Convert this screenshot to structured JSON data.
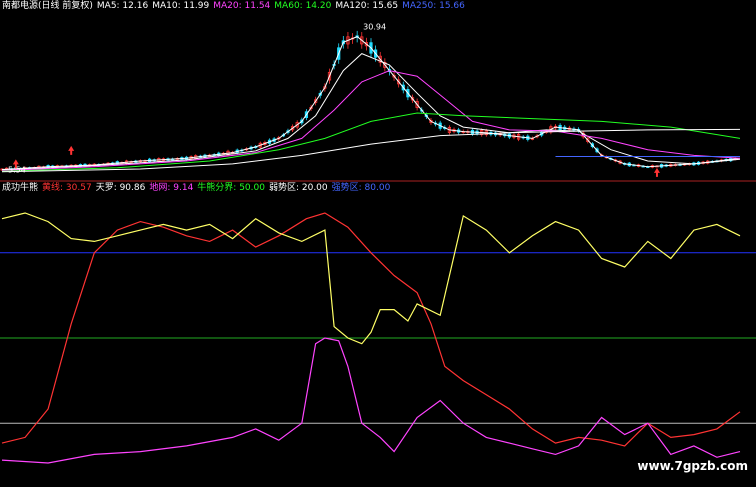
{
  "top_panel": {
    "title": "南都电源(日线 前复权)",
    "items": [
      {
        "label": "MA5: 12.16",
        "color": "#ffffff"
      },
      {
        "label": "MA10: 11.99",
        "color": "#ffffff"
      },
      {
        "label": "MA20: 11.54",
        "color": "#ff44ff"
      },
      {
        "label": "MA60: 14.20",
        "color": "#22ff22"
      },
      {
        "label": "MA120: 15.65",
        "color": "#ffffff"
      },
      {
        "label": "MA250: 15.66",
        "color": "#4466ff"
      }
    ],
    "price_high_label": "30.94",
    "price_low_label": "5.54"
  },
  "bottom_panel": {
    "title": "成功牛熊",
    "items": [
      {
        "label": "黄线: 30.57",
        "color": "#ff3333"
      },
      {
        "label": "天罗: 90.86",
        "color": "#ffffff"
      },
      {
        "label": "地网: 9.14",
        "color": "#ff44ff"
      },
      {
        "label": "牛熊分界: 50.00",
        "color": "#22ff22"
      },
      {
        "label": "弱势区: 20.00",
        "color": "#ffffff"
      },
      {
        "label": "强势区: 80.00",
        "color": "#4466ff"
      }
    ]
  },
  "watermark": "www.7gpzb.com",
  "chart_data": [
    {
      "type": "line",
      "panel": "price",
      "ylim": [
        4,
        33
      ],
      "x_count": 160,
      "series": [
        {
          "name": "MA5",
          "color": "#ffffff",
          "points": [
            [
              0,
              5.5
            ],
            [
              10,
              6
            ],
            [
              20,
              6.3
            ],
            [
              30,
              7
            ],
            [
              40,
              7.5
            ],
            [
              50,
              8.5
            ],
            [
              55,
              9.5
            ],
            [
              60,
              11
            ],
            [
              65,
              14
            ],
            [
              70,
              20
            ],
            [
              74,
              28
            ],
            [
              77,
              29
            ],
            [
              80,
              27
            ],
            [
              85,
              22
            ],
            [
              90,
              17
            ],
            [
              93,
              14
            ],
            [
              97,
              12.5
            ],
            [
              100,
              12.2
            ],
            [
              105,
              12
            ],
            [
              110,
              11.5
            ],
            [
              115,
              11
            ],
            [
              120,
              13
            ],
            [
              125,
              12.5
            ],
            [
              130,
              8
            ],
            [
              135,
              6.5
            ],
            [
              140,
              6
            ],
            [
              150,
              6.5
            ],
            [
              160,
              7.5
            ]
          ]
        },
        {
          "name": "MA10",
          "color": "#ffffff",
          "points": [
            [
              0,
              5.4
            ],
            [
              20,
              6.2
            ],
            [
              40,
              7.2
            ],
            [
              55,
              8.8
            ],
            [
              62,
              11
            ],
            [
              68,
              15
            ],
            [
              74,
              23
            ],
            [
              78,
              26
            ],
            [
              84,
              24
            ],
            [
              90,
              19
            ],
            [
              95,
              15
            ],
            [
              100,
              13
            ],
            [
              110,
              12
            ],
            [
              118,
              12.5
            ],
            [
              125,
              12.3
            ],
            [
              132,
              9
            ],
            [
              140,
              7
            ],
            [
              150,
              6.5
            ],
            [
              160,
              7.3
            ]
          ]
        },
        {
          "name": "MA20",
          "color": "#ff44ff",
          "points": [
            [
              0,
              5.3
            ],
            [
              20,
              6
            ],
            [
              40,
              7
            ],
            [
              55,
              8.5
            ],
            [
              65,
              11
            ],
            [
              72,
              16
            ],
            [
              78,
              21
            ],
            [
              84,
              23
            ],
            [
              90,
              22
            ],
            [
              96,
              18
            ],
            [
              102,
              14
            ],
            [
              110,
              12.5
            ],
            [
              120,
              12.3
            ],
            [
              130,
              11
            ],
            [
              140,
              9
            ],
            [
              150,
              8
            ],
            [
              160,
              7.5
            ]
          ]
        },
        {
          "name": "MA60",
          "color": "#22ff22",
          "points": [
            [
              0,
              5.2
            ],
            [
              25,
              5.8
            ],
            [
              45,
              7
            ],
            [
              60,
              9
            ],
            [
              70,
              11
            ],
            [
              80,
              14
            ],
            [
              90,
              15.5
            ],
            [
              100,
              15
            ],
            [
              115,
              14.5
            ],
            [
              130,
              14
            ],
            [
              145,
              13
            ],
            [
              160,
              11
            ]
          ]
        },
        {
          "name": "MA120",
          "color": "#ffffff",
          "points": [
            [
              0,
              5.1
            ],
            [
              30,
              5.6
            ],
            [
              50,
              6.5
            ],
            [
              65,
              8
            ],
            [
              80,
              10
            ],
            [
              95,
              11.5
            ],
            [
              110,
              12
            ],
            [
              125,
              12.3
            ],
            [
              140,
              12.5
            ],
            [
              160,
              12.6
            ]
          ]
        },
        {
          "name": "MA250",
          "color": "#4466ff",
          "points": [
            [
              120,
              7.8
            ],
            [
              160,
              7.8
            ]
          ]
        }
      ]
    },
    {
      "type": "line",
      "panel": "indicator",
      "ylim": [
        0,
        100
      ],
      "hlines": [
        {
          "name": "强势区",
          "value": 80,
          "color": "#2233ff",
          "x_end": 160
        },
        {
          "name": "牛熊分界",
          "value": 50,
          "color": "#22aa22",
          "x_end": 160
        },
        {
          "name": "弱势区",
          "value": 20,
          "color": "#bbbbbb",
          "x_end": 160
        }
      ],
      "series": [
        {
          "name": "黄线",
          "color": "#ff3333",
          "points": [
            [
              0,
              13
            ],
            [
              5,
              15
            ],
            [
              10,
              25
            ],
            [
              15,
              55
            ],
            [
              20,
              80
            ],
            [
              25,
              88
            ],
            [
              30,
              91
            ],
            [
              35,
              89
            ],
            [
              40,
              86
            ],
            [
              45,
              84
            ],
            [
              50,
              88
            ],
            [
              55,
              82
            ],
            [
              60,
              86
            ],
            [
              66,
              92
            ],
            [
              70,
              94
            ],
            [
              75,
              89
            ],
            [
              80,
              80
            ],
            [
              85,
              72
            ],
            [
              90,
              66
            ],
            [
              93,
              55
            ],
            [
              96,
              40
            ],
            [
              100,
              35
            ],
            [
              105,
              30
            ],
            [
              110,
              25
            ],
            [
              115,
              18
            ],
            [
              120,
              13
            ],
            [
              125,
              15
            ],
            [
              130,
              14
            ],
            [
              135,
              12
            ],
            [
              140,
              20
            ],
            [
              145,
              15
            ],
            [
              150,
              16
            ],
            [
              155,
              18
            ],
            [
              160,
              24
            ]
          ]
        },
        {
          "name": "天罗",
          "color": "#ffff66",
          "points": [
            [
              0,
              92
            ],
            [
              5,
              94
            ],
            [
              10,
              91
            ],
            [
              15,
              85
            ],
            [
              20,
              84
            ],
            [
              25,
              86
            ],
            [
              30,
              88
            ],
            [
              35,
              90
            ],
            [
              40,
              88
            ],
            [
              45,
              90
            ],
            [
              50,
              85
            ],
            [
              55,
              92
            ],
            [
              60,
              87
            ],
            [
              65,
              84
            ],
            [
              70,
              88
            ],
            [
              72,
              54
            ],
            [
              75,
              50
            ],
            [
              78,
              48
            ],
            [
              80,
              52
            ],
            [
              82,
              60
            ],
            [
              85,
              60
            ],
            [
              88,
              56
            ],
            [
              90,
              62
            ],
            [
              95,
              58
            ],
            [
              100,
              93
            ],
            [
              105,
              88
            ],
            [
              110,
              80
            ],
            [
              115,
              86
            ],
            [
              120,
              91
            ],
            [
              125,
              88
            ],
            [
              130,
              78
            ],
            [
              135,
              75
            ],
            [
              140,
              84
            ],
            [
              145,
              78
            ],
            [
              150,
              88
            ],
            [
              155,
              90
            ],
            [
              160,
              86
            ]
          ]
        },
        {
          "name": "地网",
          "color": "#ff44ff",
          "points": [
            [
              0,
              7
            ],
            [
              10,
              6
            ],
            [
              20,
              9
            ],
            [
              30,
              10
            ],
            [
              40,
              12
            ],
            [
              50,
              15
            ],
            [
              55,
              18
            ],
            [
              60,
              14
            ],
            [
              65,
              20
            ],
            [
              68,
              48
            ],
            [
              70,
              50
            ],
            [
              73,
              49
            ],
            [
              75,
              40
            ],
            [
              78,
              20
            ],
            [
              82,
              15
            ],
            [
              85,
              10
            ],
            [
              90,
              22
            ],
            [
              95,
              28
            ],
            [
              100,
              20
            ],
            [
              105,
              15
            ],
            [
              110,
              13
            ],
            [
              115,
              11
            ],
            [
              120,
              9
            ],
            [
              125,
              12
            ],
            [
              130,
              22
            ],
            [
              135,
              16
            ],
            [
              140,
              20
            ],
            [
              145,
              9
            ],
            [
              150,
              12
            ],
            [
              155,
              8
            ],
            [
              160,
              10
            ]
          ]
        }
      ]
    }
  ]
}
